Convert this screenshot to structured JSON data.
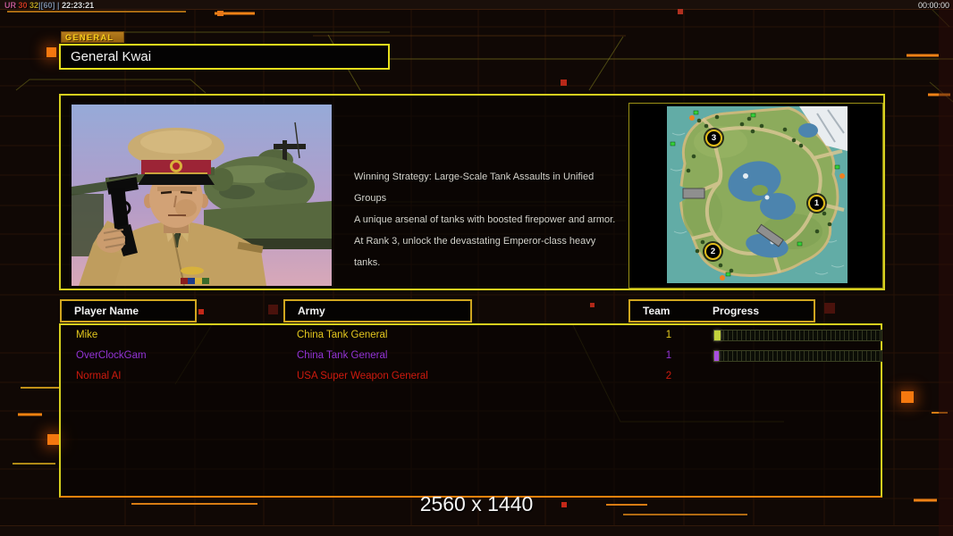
{
  "theme": {
    "accent_yellow": "#d6cf1e",
    "accent_gold": "#cfa51f",
    "accent_orange": "#ef820c",
    "background": "#100805"
  },
  "status_bar": {
    "segments": [
      {
        "text": "UR ",
        "color": "#c05890"
      },
      {
        "text": "30 ",
        "color": "#cc3820"
      },
      {
        "text": "32",
        "color": "#b8a020"
      },
      {
        "text": "|[60] | ",
        "color": "#7888a0"
      },
      {
        "text": "22:23:21",
        "color": "#dcdcdc"
      }
    ],
    "match_timer": "00:00:00"
  },
  "general_panel": {
    "tab_label": "GENERAL",
    "name": "General Kwai"
  },
  "briefing": {
    "lines": [
      "Winning Strategy: Large-Scale Tank Assaults in Unified Groups",
      "A unique arsenal of tanks with boosted firepower and armor.",
      "At Rank 3, unlock the devastating Emperor-class heavy tanks."
    ]
  },
  "map_preview": {
    "markers": [
      {
        "label": "3"
      },
      {
        "label": "1"
      },
      {
        "label": "2"
      }
    ]
  },
  "lobby_table": {
    "headers": {
      "player": "Player Name",
      "army": "Army",
      "team": "Team",
      "progress": "Progress"
    },
    "rows": [
      {
        "name": "Mike",
        "army": "China Tank General",
        "team": "1",
        "color": "#e3c81e",
        "progress_percent": 4,
        "bar_color": "#c3d23c"
      },
      {
        "name": "OverClockGam",
        "army": "China Tank General",
        "team": "1",
        "color": "#9333d6",
        "progress_percent": 2.5,
        "bar_color": "#a94fe0"
      },
      {
        "name": "Normal AI",
        "army": "USA Super Weapon General",
        "team": "2",
        "color": "#cf1a0e",
        "progress_percent": null,
        "bar_color": null
      }
    ]
  },
  "footer": {
    "resolution_label": "2560 x 1440"
  }
}
